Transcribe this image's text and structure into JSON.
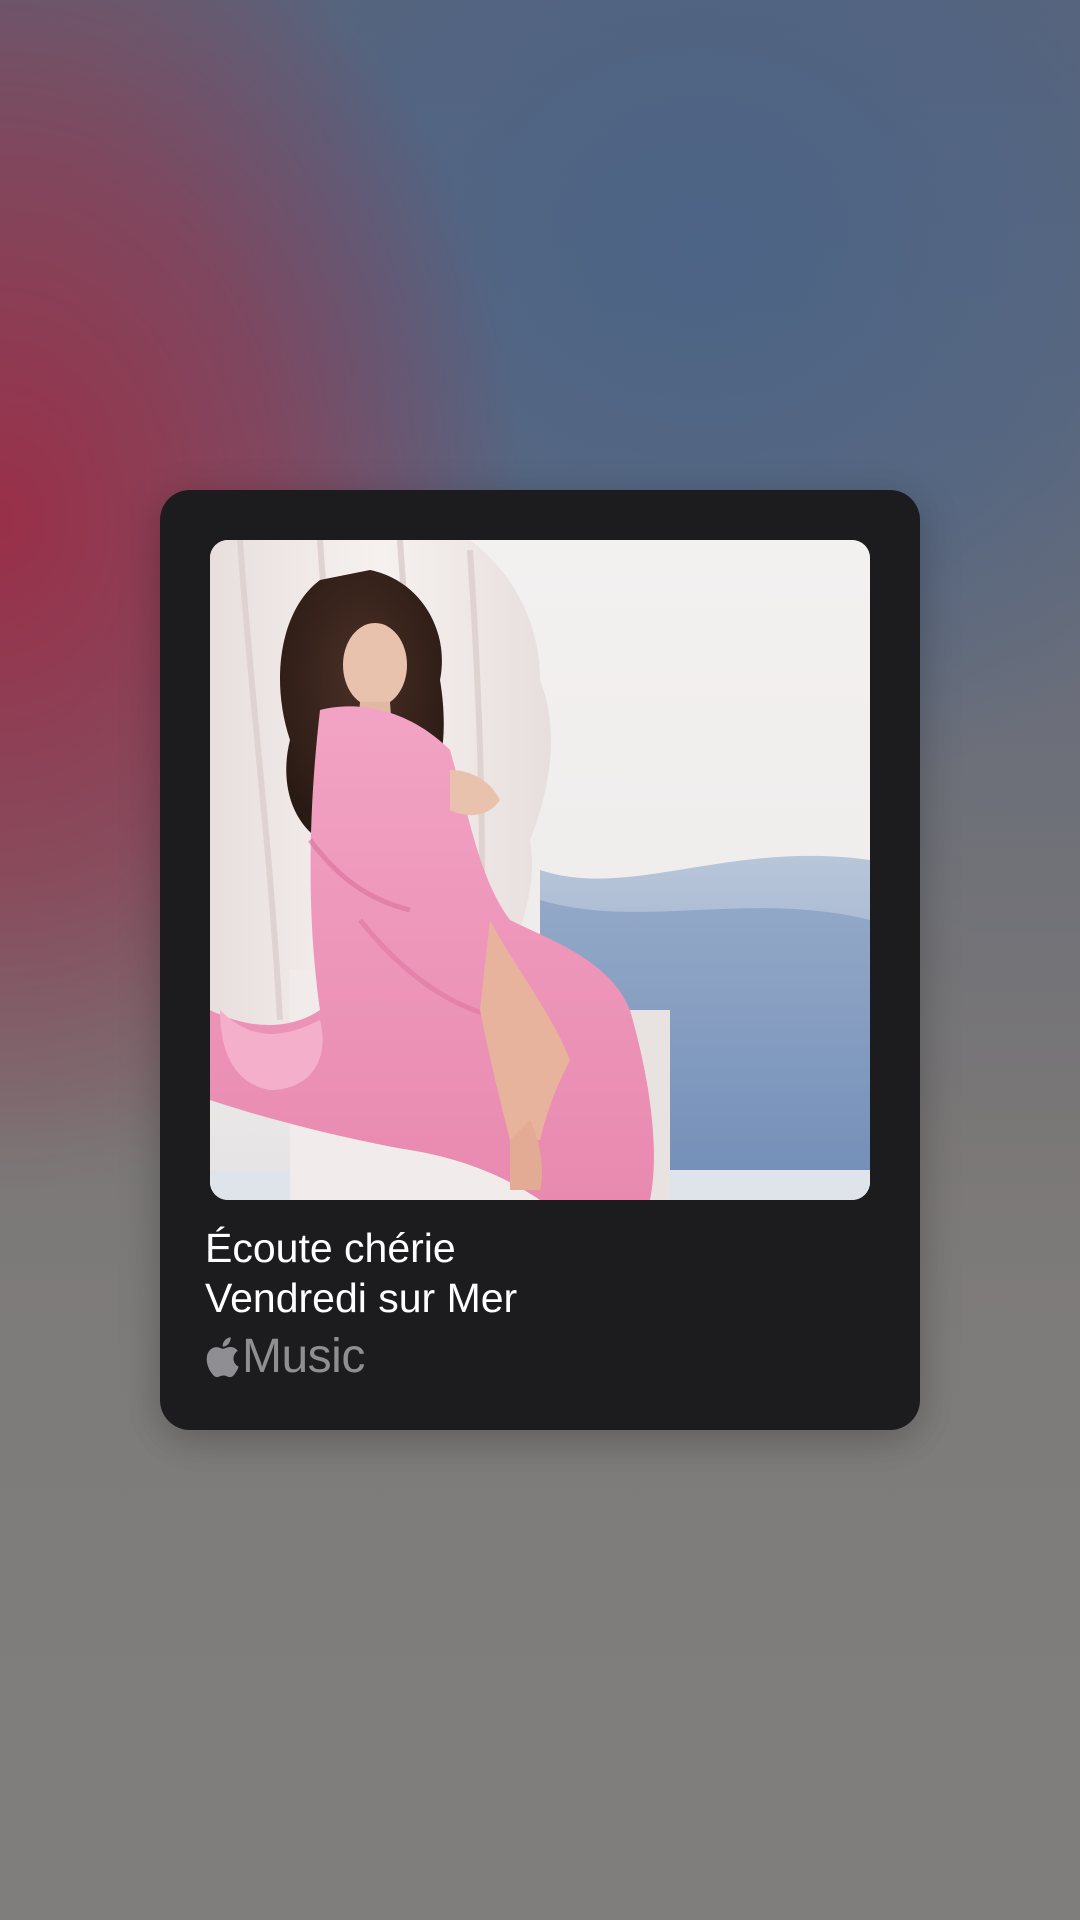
{
  "now_playing": {
    "song_title": "Écoute chérie",
    "artist": "Vendredi sur Mer",
    "artwork_icon": "album-artwork-image",
    "service": {
      "icon": "apple-logo-icon",
      "label": "Music"
    }
  },
  "colors": {
    "card_background": "#1c1c1e",
    "title_text": "#ffffff",
    "service_text": "#8e8e93",
    "background_red": "#9c2c46",
    "background_blue": "#4b6487",
    "background_gray": "#7f7e7c"
  }
}
